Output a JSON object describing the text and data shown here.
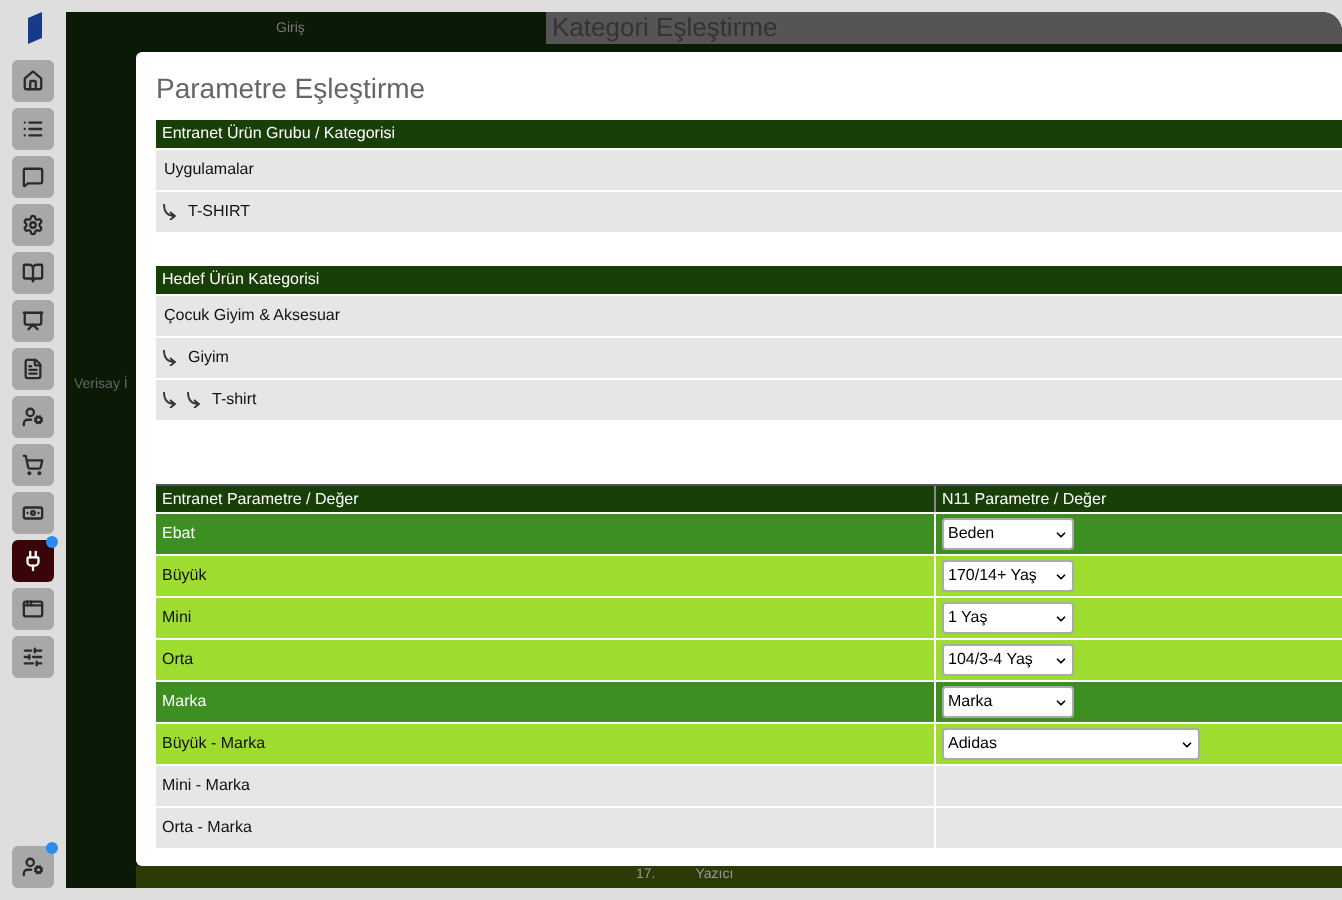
{
  "sidebar": {
    "items": [
      {
        "selected": false,
        "badge": false
      },
      {
        "selected": false,
        "badge": false
      },
      {
        "selected": false,
        "badge": false
      },
      {
        "selected": false,
        "badge": false
      },
      {
        "selected": false,
        "badge": false
      },
      {
        "selected": false,
        "badge": false
      },
      {
        "selected": false,
        "badge": false
      },
      {
        "selected": false,
        "badge": false
      },
      {
        "selected": false,
        "badge": false
      },
      {
        "selected": false,
        "badge": false
      },
      {
        "selected": true,
        "badge": true
      },
      {
        "selected": false,
        "badge": false
      },
      {
        "selected": false,
        "badge": false
      }
    ],
    "bottom_item": {
      "badge": true
    }
  },
  "background": {
    "menu_item": "Giriş",
    "brand": "Verisay İ",
    "page_title": "Kategori Eşleştirme",
    "row_number": "17.",
    "row_label": "Yazıcı"
  },
  "modal": {
    "title": "Parametre Eşleştirme",
    "source_category": {
      "header": "Entranet Ürün Grubu / Kategorisi",
      "tree": [
        {
          "label": "Uygulamalar",
          "children": [
            {
              "label": "T-SHIRT"
            }
          ]
        }
      ]
    },
    "target_category": {
      "header": "Hedef Ürün Kategorisi",
      "tree": [
        {
          "label": "Çocuk Giyim & Aksesuar",
          "children": [
            {
              "label": "Giyim",
              "children": [
                {
                  "label": "T-shirt"
                }
              ]
            }
          ]
        }
      ]
    },
    "parameters": {
      "columns": [
        "Entranet Parametre / Değer",
        "N11 Parametre / Değer"
      ],
      "rows": [
        {
          "kind": "parameter",
          "label": "Ebat",
          "value": "Beden"
        },
        {
          "kind": "matched",
          "label": "Büyük",
          "value": "170/14+ Yaş"
        },
        {
          "kind": "matched",
          "label": "Mini",
          "value": "1 Yaş"
        },
        {
          "kind": "matched",
          "label": "Orta",
          "value": "104/3-4 Yaş"
        },
        {
          "kind": "parameter",
          "label": "Marka",
          "value": "Marka"
        },
        {
          "kind": "brand",
          "label": "Büyük - Marka",
          "value": "Adidas"
        },
        {
          "kind": "unmatched",
          "label": "Mini - Marka"
        },
        {
          "kind": "unmatched",
          "label": "Orta - Marka"
        }
      ]
    }
  }
}
